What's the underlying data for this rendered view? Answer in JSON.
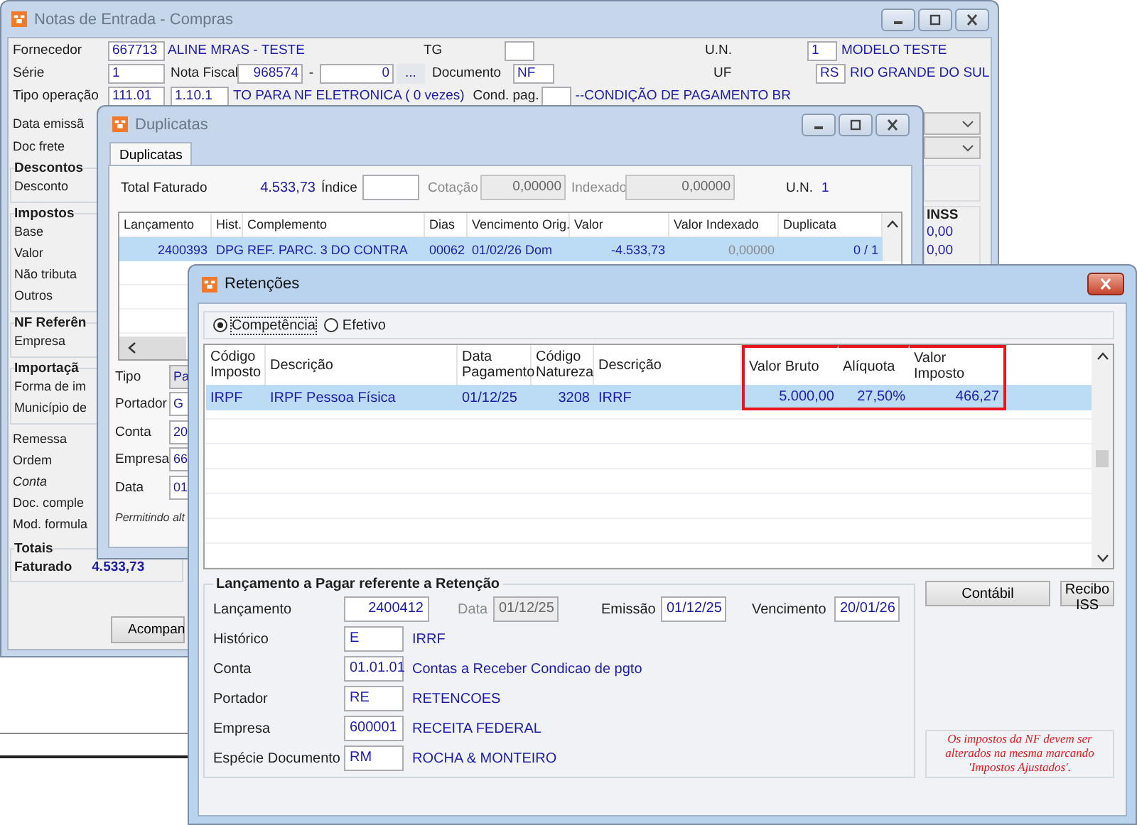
{
  "main_window": {
    "title": "Notas de Entrada - Compras",
    "active": false,
    "fornecedor": {
      "label": "Fornecedor",
      "code": "667713",
      "name": "ALINE MRAS - TESTE"
    },
    "tg": {
      "label": "TG"
    },
    "un": {
      "label": "U.N.",
      "code": "1",
      "name": "MODELO TESTE"
    },
    "serie": {
      "label": "Série",
      "value": "1"
    },
    "nota_fiscal": {
      "label": "Nota Fiscal",
      "number": "968574",
      "separator": "-",
      "series": "0",
      "lookup": "..."
    },
    "documento": {
      "label": "Documento",
      "value": "NF"
    },
    "uf": {
      "label": "UF",
      "code": "RS",
      "name": "RIO GRANDE DO SUL"
    },
    "tipo_operacao": {
      "label": "Tipo operação",
      "code": "111.01",
      "cfop": "1.10.1",
      "description": "TO PARA NF ELETRONICA ( 0 vezes)"
    },
    "cond_pag": {
      "label": "Cond. pag.",
      "description": "--CONDIÇÃO DE PAGAMENTO BR"
    },
    "labels": [
      {
        "text": "Data emissã",
        "italic": false
      },
      {
        "text": "Doc frete",
        "italic": false
      }
    ],
    "groups": [
      {
        "title": "Descontos",
        "items": [
          "Desconto"
        ]
      },
      {
        "title": "Impostos",
        "items": [
          "Base",
          "Valor",
          "Não tributa",
          "Outros"
        ]
      },
      {
        "title": "NF Referên",
        "items": [
          "Empresa"
        ]
      },
      {
        "title": "Importaçã",
        "items": [
          "Forma de im",
          "Município de"
        ]
      }
    ],
    "more_labels": [
      {
        "text": "Remessa",
        "italic": false
      },
      {
        "text": "Ordem",
        "italic": false
      },
      {
        "text": "Conta",
        "italic": true
      },
      {
        "text": "Doc. comple",
        "italic": false
      },
      {
        "text": "Mod. formula",
        "italic": false
      }
    ],
    "totais": {
      "title": "Totais",
      "label": "Faturado",
      "value": "4.533,73"
    },
    "button": "Acompan",
    "inss": {
      "title": "INSS",
      "values": [
        "0,00",
        "0,00"
      ]
    }
  },
  "duplicatas_window": {
    "title": "Duplicatas",
    "active": false,
    "tabs": [
      {
        "label": "Duplicatas",
        "selected": true
      }
    ],
    "total_faturado": {
      "label": "Total Faturado",
      "value": "4.533,73"
    },
    "indice": {
      "label": "Índice",
      "disabled": false
    },
    "cotacao": {
      "label": "Cotação",
      "value": "0,00000",
      "disabled": true
    },
    "indexado": {
      "label": "Indexado",
      "value": "0,00000",
      "disabled": true
    },
    "un": {
      "label": "U.N.",
      "value": "1"
    },
    "table": {
      "columns": [
        "Lançamento",
        "Hist.",
        "Complemento",
        "Dias",
        "Vencimento Orig.",
        "Valor",
        "Valor Indexado",
        "Duplicata"
      ],
      "rows": [
        {
          "selected": true,
          "cells": [
            "2400393",
            "DPG",
            "REF. PARC. 3 DO CONTRA",
            "00062",
            "01/02/26 Dom",
            "-4.533,73",
            "0,00000",
            "0 / 1"
          ]
        }
      ]
    },
    "fields": [
      {
        "label": "Tipo",
        "value": "Pa",
        "kind": "select"
      },
      {
        "label": "Portador",
        "value": "G",
        "kind": "input"
      },
      {
        "label": "Conta",
        "value": "20",
        "kind": "input"
      },
      {
        "label": "Empresa",
        "value": "66",
        "kind": "input"
      },
      {
        "label": "Data",
        "value": "01",
        "kind": "input"
      }
    ],
    "note": "Permitindo alt"
  },
  "retencoes_window": {
    "title": "Retenções",
    "active": true,
    "radios": [
      {
        "label": "Competência",
        "selected": true
      },
      {
        "label": "Efetivo",
        "selected": false
      }
    ],
    "table": {
      "columns": [
        {
          "label": "Código Imposto",
          "highlighted": false
        },
        {
          "label": "Descrição",
          "highlighted": false
        },
        {
          "label": "Data Pagamento",
          "highlighted": false
        },
        {
          "label": "Código Natureza",
          "highlighted": false
        },
        {
          "label": "Descrição",
          "highlighted": false
        },
        {
          "label": "Valor Bruto",
          "highlighted": true
        },
        {
          "label": "Alíquota",
          "highlighted": true
        },
        {
          "label": "Valor Imposto",
          "highlighted": true
        }
      ],
      "rows": [
        {
          "selected": true,
          "cells": [
            "IRPF",
            "IRPF Pessoa Física",
            "01/12/25",
            "3208",
            "IRRF",
            "5.000,00",
            "27,50%",
            "466,27"
          ]
        }
      ]
    },
    "lancamento": {
      "title": "Lançamento a Pagar referente a Retenção",
      "lancamento": {
        "label": "Lançamento",
        "value": "2400412"
      },
      "data": {
        "label": "Data",
        "value": "01/12/25",
        "disabled": true
      },
      "emissao": {
        "label": "Emissão",
        "value": "01/12/25"
      },
      "vencimento": {
        "label": "Vencimento",
        "value": "20/01/26"
      },
      "rows": [
        {
          "label": "Histórico",
          "code": "E",
          "name": "IRRF"
        },
        {
          "label": "Conta",
          "code": "01.01.01",
          "name": "Contas a Receber Condicao de pgto"
        },
        {
          "label": "Portador",
          "code": "RE",
          "name": "RETENCOES"
        },
        {
          "label": "Empresa",
          "code": "600001",
          "name": "RECEITA FEDERAL"
        },
        {
          "label": "Espécie Documento",
          "code": "RM",
          "name": "ROCHA & MONTEIRO"
        }
      ]
    },
    "buttons": [
      "Contábil",
      "Recibo ISS"
    ],
    "notice": "Os impostos da NF devem ser alterados na mesma marcando 'Impostos Ajustados'."
  }
}
